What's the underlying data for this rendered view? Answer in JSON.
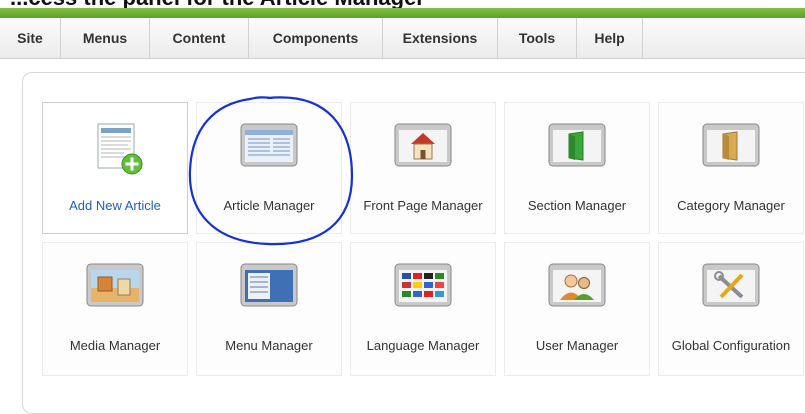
{
  "heading": "...cess the panel for the Article Manager",
  "menu": [
    {
      "label": "Site"
    },
    {
      "label": "Menus"
    },
    {
      "label": "Content"
    },
    {
      "label": "Components"
    },
    {
      "label": "Extensions"
    },
    {
      "label": "Tools"
    },
    {
      "label": "Help"
    }
  ],
  "tiles_row1": [
    {
      "label": "Add New Article",
      "icon": "add-article-icon",
      "active": true
    },
    {
      "label": "Article Manager",
      "icon": "article-manager-icon",
      "circled": true
    },
    {
      "label": "Front Page Manager",
      "icon": "home-icon"
    },
    {
      "label": "Section Manager",
      "icon": "section-icon"
    },
    {
      "label": "Category Manager",
      "icon": "category-icon"
    }
  ],
  "tiles_row2": [
    {
      "label": "Media Manager",
      "icon": "media-icon"
    },
    {
      "label": "Menu Manager",
      "icon": "menu-manager-icon"
    },
    {
      "label": "Language Manager",
      "icon": "flags-icon"
    },
    {
      "label": "User Manager",
      "icon": "users-icon"
    },
    {
      "label": "Global Configuration",
      "icon": "tools-icon"
    }
  ],
  "colors": {
    "accent_green": "#6fb236",
    "link_blue": "#1f5fb8",
    "annotation_blue": "#1432d6"
  }
}
